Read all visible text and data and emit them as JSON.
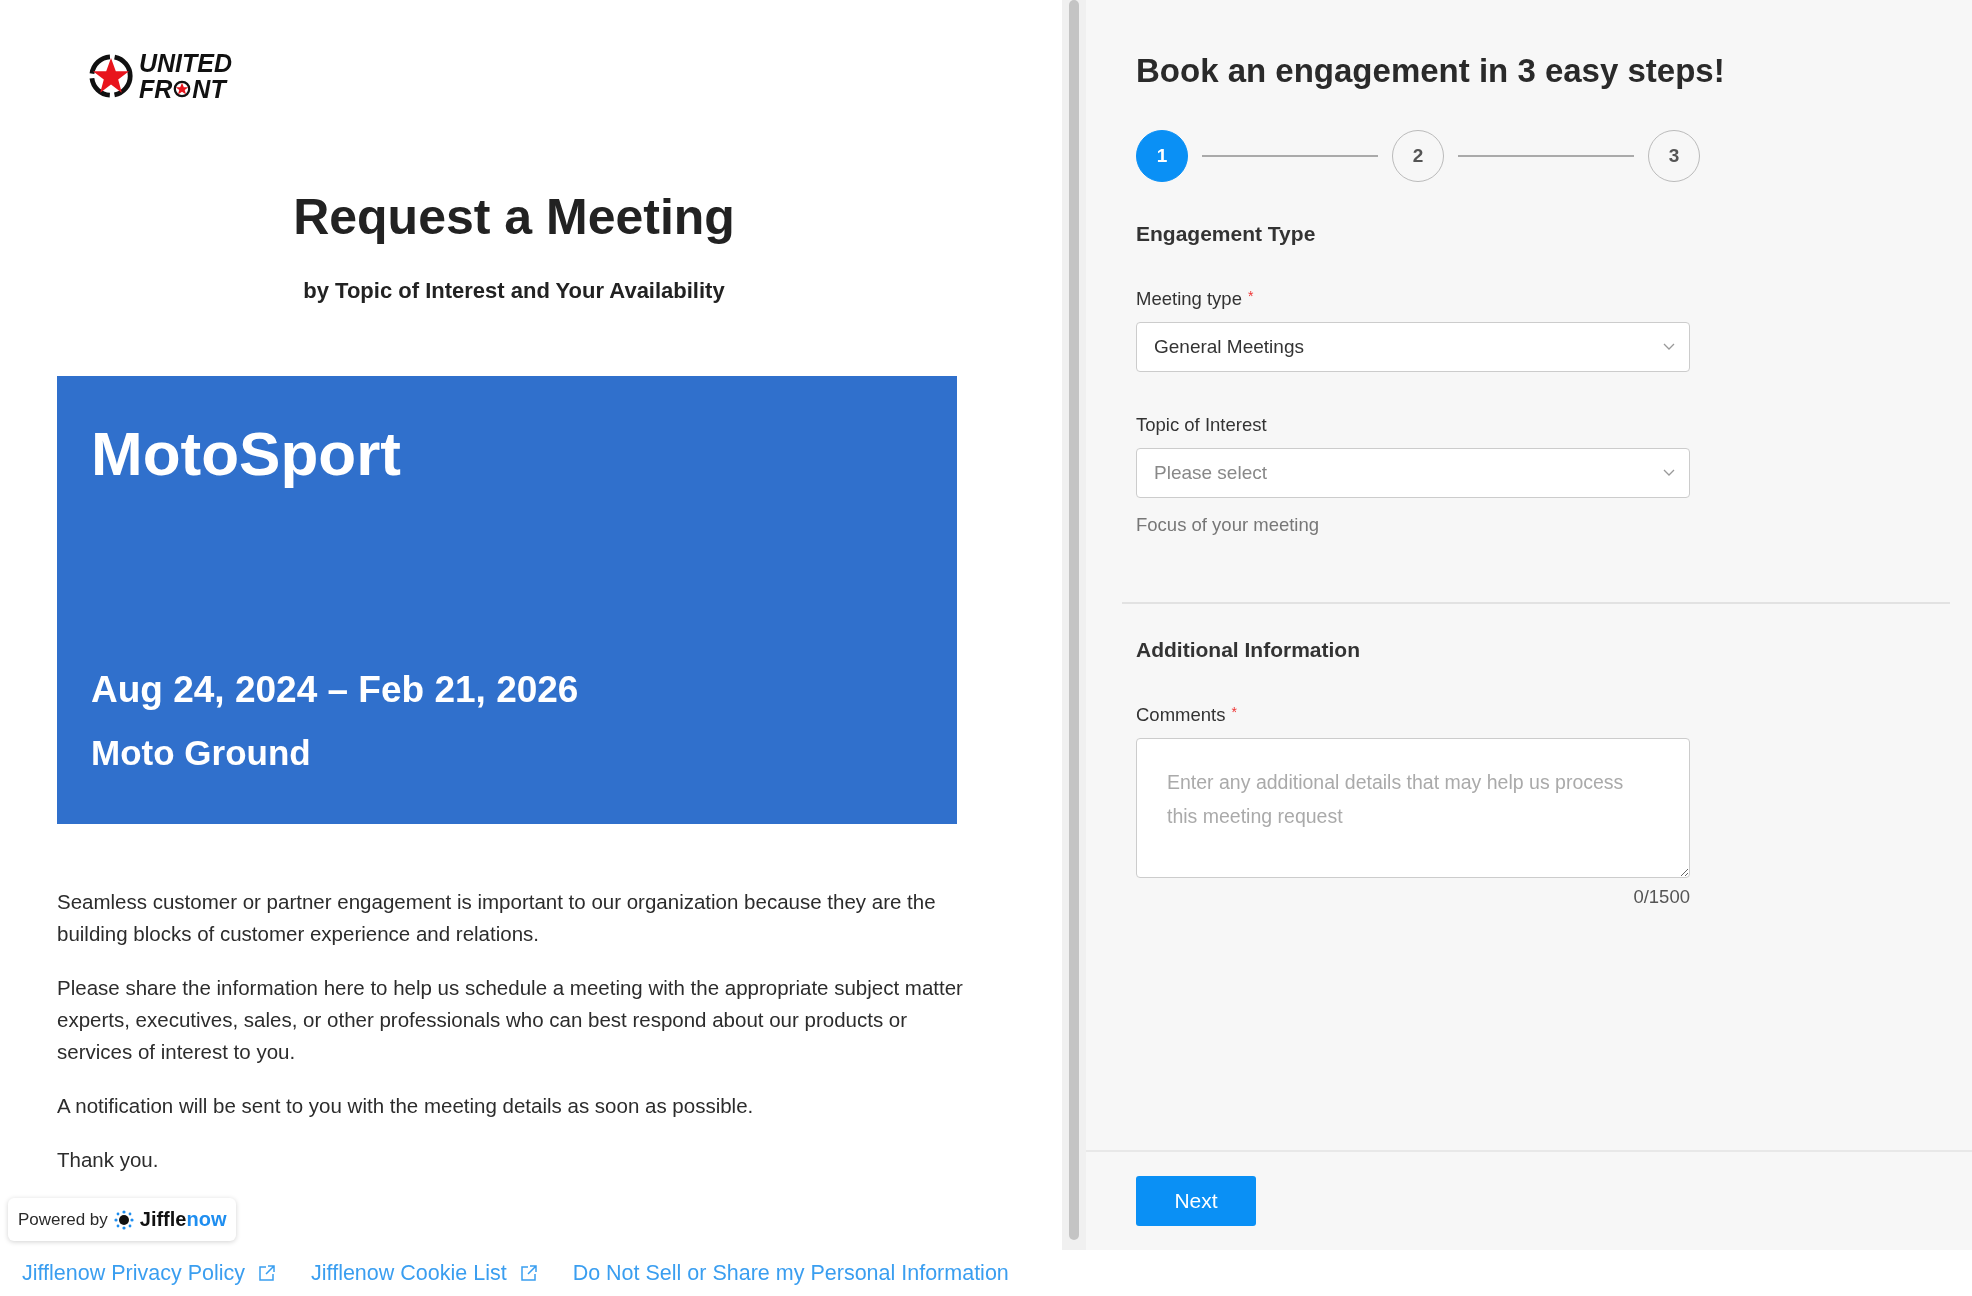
{
  "logo": {
    "line_1": "UNITED",
    "line_2_parts": [
      "FR",
      "NT"
    ]
  },
  "title": "Request a Meeting",
  "subtitle": "by Topic of Interest and Your Availability",
  "banner": {
    "title": "MotoSport",
    "dates": "Aug 24, 2024 – Feb 21, 2026",
    "venue": "Moto Ground"
  },
  "paragraphs": [
    "Seamless customer or partner engagement is important to our organization because they are the building blocks of customer experience and relations.",
    "Please share the information here to help us schedule a meeting with the appropriate subject matter experts, executives, sales, or other professionals who can best respond about our products or services of interest to you.",
    "A notification will be sent to you with the meeting details as soon as possible.",
    "Thank you."
  ],
  "powered_by": {
    "label": "Powered by",
    "brand": [
      "Jiffle",
      "now"
    ]
  },
  "footer_links": [
    {
      "label": "Jifflenow Privacy Policy",
      "external": true
    },
    {
      "label": "Jifflenow Cookie List",
      "external": true
    },
    {
      "label": "Do Not Sell or Share my Personal Information",
      "external": false
    }
  ],
  "form": {
    "heading": "Book an engagement in 3 easy steps!",
    "required_mark": "*",
    "steps": [
      {
        "label": "1",
        "selected": true
      },
      {
        "label": "2",
        "selected": false
      },
      {
        "label": "3",
        "selected": false
      }
    ],
    "sections": [
      {
        "title": "Engagement Type",
        "fields": [
          {
            "kind": "select",
            "label": "Meeting type",
            "required": true,
            "value": "General Meetings"
          },
          {
            "kind": "select",
            "label": "Topic of Interest",
            "required": false,
            "placeholder": "Please select",
            "help": "Focus of your meeting"
          }
        ]
      },
      {
        "title": "Additional Information",
        "fields": [
          {
            "kind": "textarea",
            "label": "Comments",
            "required": true,
            "placeholder": "Enter any additional details that may help us process this meeting request",
            "counter": "0/1500"
          }
        ]
      }
    ],
    "next_button": "Next"
  }
}
